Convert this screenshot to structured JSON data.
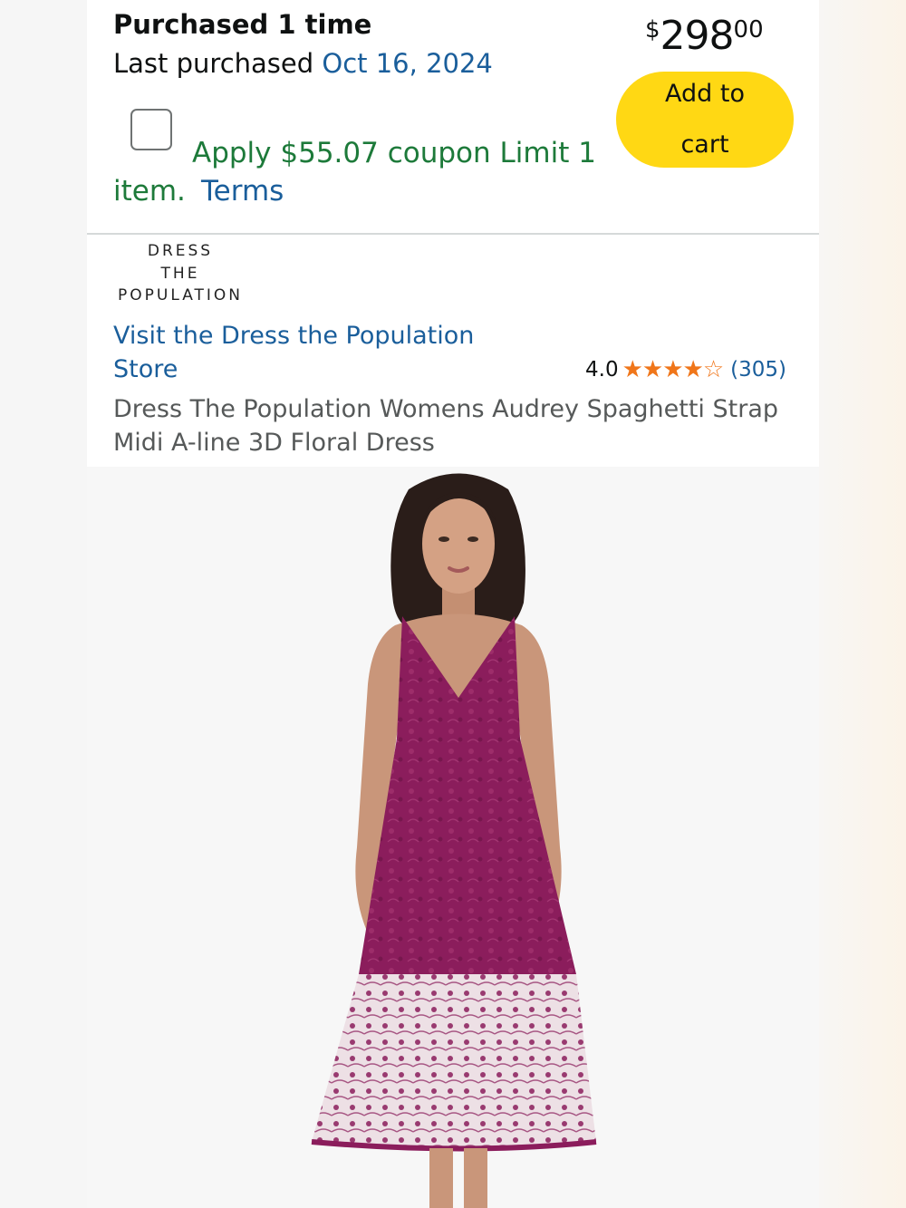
{
  "purchase": {
    "count_text": "Purchased 1 time",
    "last_label": "Last purchased ",
    "last_date": "Oct 16, 2024"
  },
  "price": {
    "symbol": "$",
    "whole": "298",
    "fraction": "00"
  },
  "cart": {
    "line1": "Add to",
    "line2": "cart"
  },
  "coupon": {
    "checked": false,
    "text_line1": "Apply $55.07 coupon Limit 1",
    "text_line2": "item.",
    "terms_label": "Terms"
  },
  "brand": {
    "logo_line1": "DRESS",
    "logo_line2": "THE",
    "logo_line3": "POPULATION",
    "store_link_line1": "Visit the Dress the Population",
    "store_link_line2": "Store"
  },
  "rating": {
    "value": "4.0",
    "stars": "★★★★☆",
    "count": "(305)"
  },
  "product": {
    "title_line1": "Dress The Population Womens Audrey Spaghetti Strap",
    "title_line2": "Midi A-line 3D Floral Dress"
  },
  "colors": {
    "accent_link": "#1a5e9b",
    "coupon_green": "#1d7a3a",
    "cart_button": "#ffd814",
    "star_orange": "#f0761a",
    "dress": "#8b1d5c"
  },
  "icons": {
    "checkbox": "checkbox-icon",
    "star": "star-icon"
  }
}
